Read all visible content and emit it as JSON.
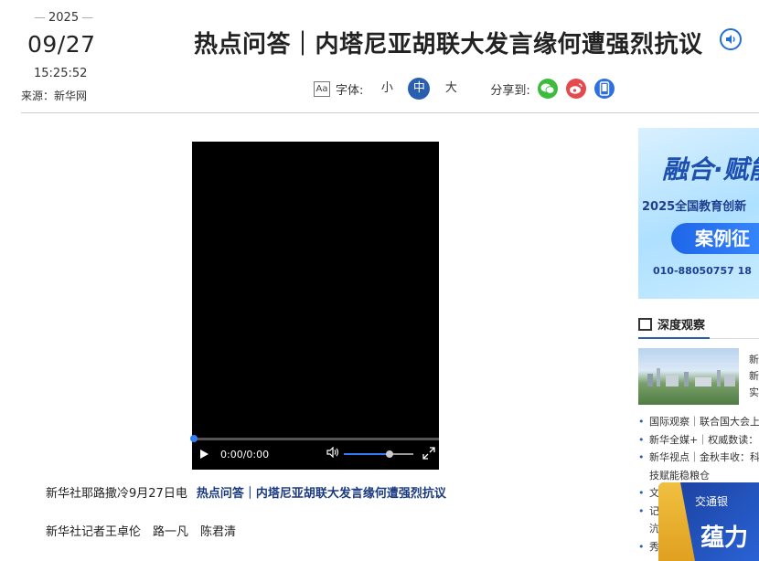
{
  "header": {
    "year": "2025",
    "date": "09/27",
    "time": "15:25:52",
    "source": "来源：新华网",
    "title": "热点问答｜内塔尼亚胡联大发言缘何遭强烈抗议",
    "font_label": "字体:",
    "font_sizes": [
      "小",
      "中",
      "大"
    ],
    "font_active": "中",
    "share_label": "分享到:",
    "aa_icon_text": "Aa"
  },
  "video": {
    "time_display": "0:00/0:00",
    "progress": 0,
    "volume": 0.66
  },
  "article": {
    "lead_prefix": "新华社耶路撒冷9月27日电",
    "lead_title": "热点问答｜内塔尼亚胡联大发言缘何遭强烈抗议",
    "byline": "新华社记者王卓伦　路一凡　陈君清"
  },
  "sidebar": {
    "banner": {
      "script_text": "融合·赋能",
      "line": "2025全国教育创新",
      "pill": "案例征",
      "phone": "010-88050757 18"
    },
    "section_title": "深度观察",
    "thumb_text": "新新实",
    "news": [
      "国际观察｜联合国大会上",
      "新华全媒+｜权威数读：",
      "新华视点｜金秋丰收：科",
      "技赋能稳粮仓",
      "文",
      "记",
      "沆",
      "秀"
    ]
  },
  "float_ad": {
    "logo": "交通银",
    "text": "蕴力"
  },
  "colors": {
    "accent": "#2a5fb0",
    "wechat": "#3dbb3d",
    "weibo": "#e5484d",
    "mobile": "#2f6fe0"
  }
}
